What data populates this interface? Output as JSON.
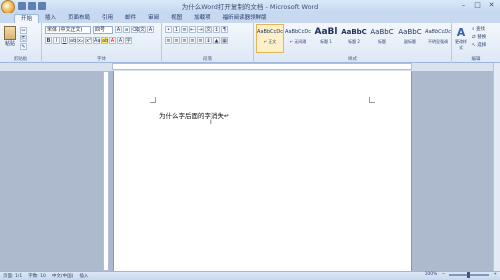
{
  "title": "为什么Word打开复制的文档 - Microsoft Word",
  "tabs": [
    "开始",
    "插入",
    "页面布局",
    "引用",
    "邮件",
    "审阅",
    "视图",
    "加载项",
    "福昕阅读器领鲜版"
  ],
  "clipboard": {
    "paste": "粘贴",
    "group": "剪贴板"
  },
  "font": {
    "name": "宋体 (中文正文)",
    "size": "四号",
    "group": "字体"
  },
  "paragraph": {
    "group": "段落"
  },
  "styles": {
    "group": "样式",
    "items": [
      {
        "sample": "AaBbCcDc",
        "name": "↵ 正文"
      },
      {
        "sample": "AaBbCcDc",
        "name": "↵ 无间隔"
      },
      {
        "sample": "AaBl",
        "name": "标题 1"
      },
      {
        "sample": "AaBbC",
        "name": "标题 2"
      },
      {
        "sample": "AaBbC",
        "name": "标题"
      },
      {
        "sample": "AaBbC",
        "name": "副标题"
      },
      {
        "sample": "AaBbCcDc",
        "name": "不明显强调"
      }
    ],
    "change": "更改样式"
  },
  "editing": {
    "find": "查找",
    "replace": "替换",
    "select": "选择",
    "group": "编辑"
  },
  "document": {
    "text": "为什么字后面的字消失↵"
  },
  "status": {
    "page": "页面: 1/1",
    "words": "字数: 10",
    "lang": "中文(中国)",
    "insert": "插入"
  },
  "zoom": "100%"
}
